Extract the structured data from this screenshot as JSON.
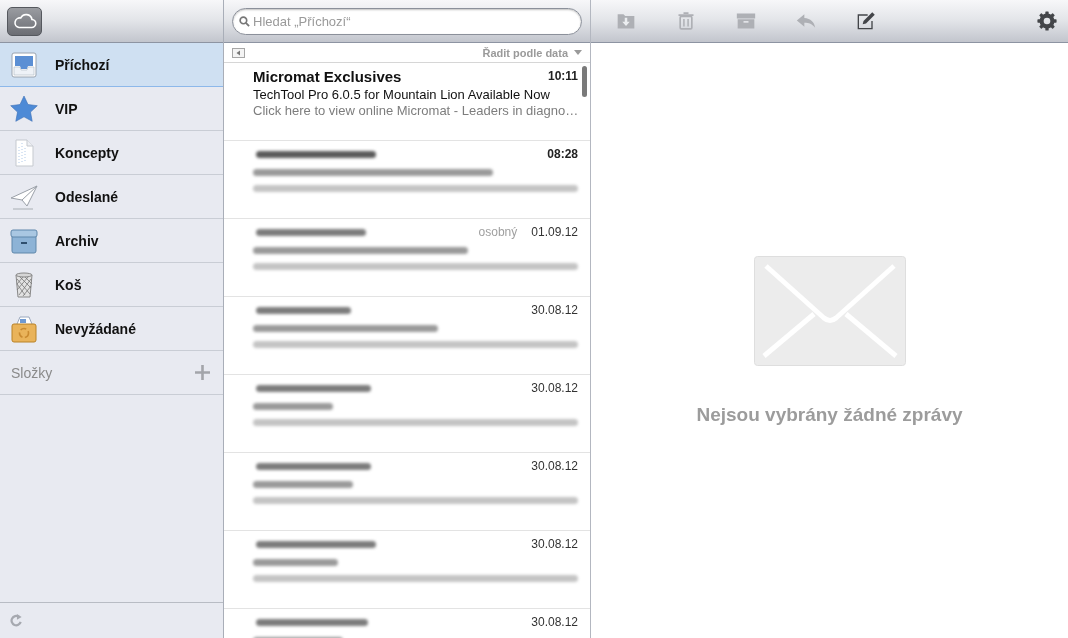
{
  "sidebar": {
    "items": [
      {
        "label": "Příchozí",
        "kind": "inbox",
        "selected": true
      },
      {
        "label": "VIP",
        "kind": "vip",
        "selected": false
      },
      {
        "label": "Koncepty",
        "kind": "drafts",
        "selected": false
      },
      {
        "label": "Odeslané",
        "kind": "sent",
        "selected": false
      },
      {
        "label": "Archiv",
        "kind": "archive",
        "selected": false
      },
      {
        "label": "Koš",
        "kind": "trash",
        "selected": false
      },
      {
        "label": "Nevyžádané",
        "kind": "junk",
        "selected": false
      }
    ],
    "section": {
      "label": "Složky"
    }
  },
  "search": {
    "placeholder": "Hledat „Příchozí“"
  },
  "list": {
    "sort_label": "Řadit podle data",
    "messages": [
      {
        "sender": "Micromat Exclusives",
        "subject": "TechTool Pro 6.0.5 for Mountain Lion Available Now",
        "preview": "Click here to view online Micromat - Leaders in diagno…",
        "time": "10:11",
        "unread": true,
        "redacted": false
      },
      {
        "time": "08:28",
        "unread": true,
        "redacted": true
      },
      {
        "label": "osobný",
        "time": "01.09.12",
        "unread": false,
        "redacted": true
      },
      {
        "time": "30.08.12",
        "unread": false,
        "redacted": true
      },
      {
        "time": "30.08.12",
        "unread": false,
        "redacted": true
      },
      {
        "time": "30.08.12",
        "unread": false,
        "redacted": true
      },
      {
        "time": "30.08.12",
        "unread": false,
        "redacted": true
      },
      {
        "time": "30.08.12",
        "unread": false,
        "redacted": true
      }
    ]
  },
  "toolbar": {
    "buttons": [
      {
        "kind": "move",
        "disabled": true
      },
      {
        "kind": "delete",
        "disabled": true
      },
      {
        "kind": "archive",
        "disabled": true
      },
      {
        "kind": "reply",
        "disabled": true
      },
      {
        "kind": "compose",
        "disabled": false
      },
      {
        "kind": "settings",
        "disabled": false
      }
    ]
  },
  "viewer": {
    "empty_message": "Nejsou vybrány žádné zprávy"
  }
}
